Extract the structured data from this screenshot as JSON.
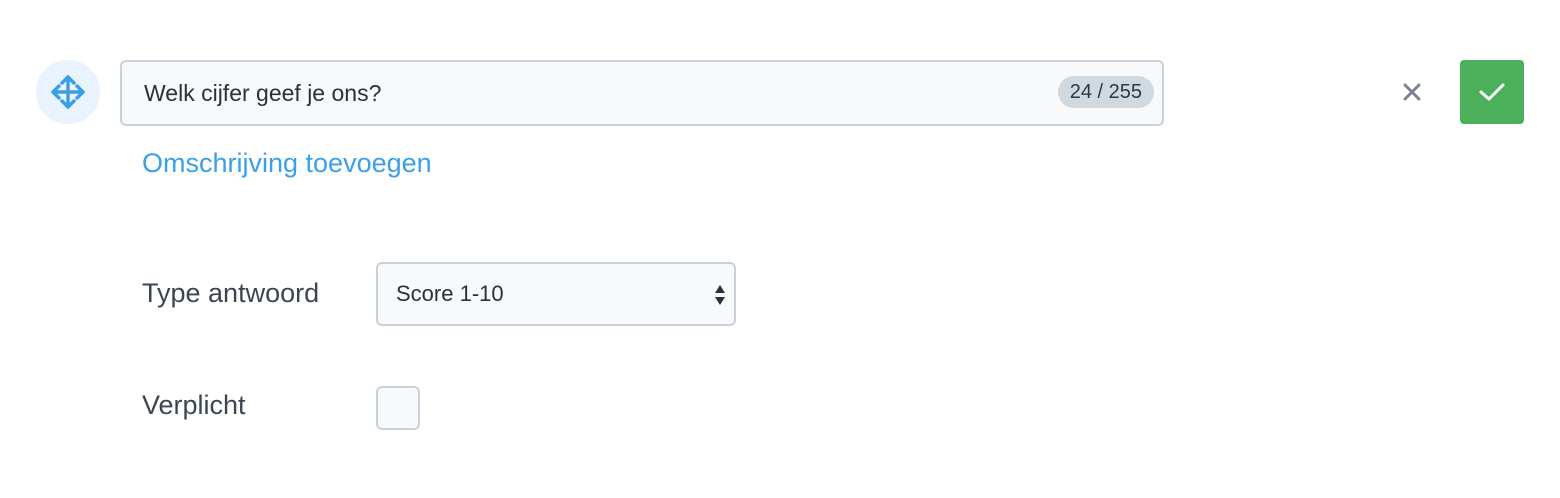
{
  "question": {
    "value": "Welk cijfer geef je ons?",
    "counter": "24 / 255"
  },
  "links": {
    "add_description": "Omschrijving toevoegen"
  },
  "answer_type": {
    "label": "Type antwoord",
    "selected": "Score 1-10"
  },
  "required": {
    "label": "Verplicht",
    "checked": false
  },
  "icons": {
    "drag": "move-arrows-icon",
    "cancel": "close-icon",
    "confirm": "checkmark-icon",
    "select": "sort-arrows-icon"
  },
  "colors": {
    "accent": "#3aa0e8",
    "confirm": "#4cb05b",
    "drag_bg": "#e8f3fd",
    "border": "#c9d1da",
    "text": "#3b4653"
  }
}
